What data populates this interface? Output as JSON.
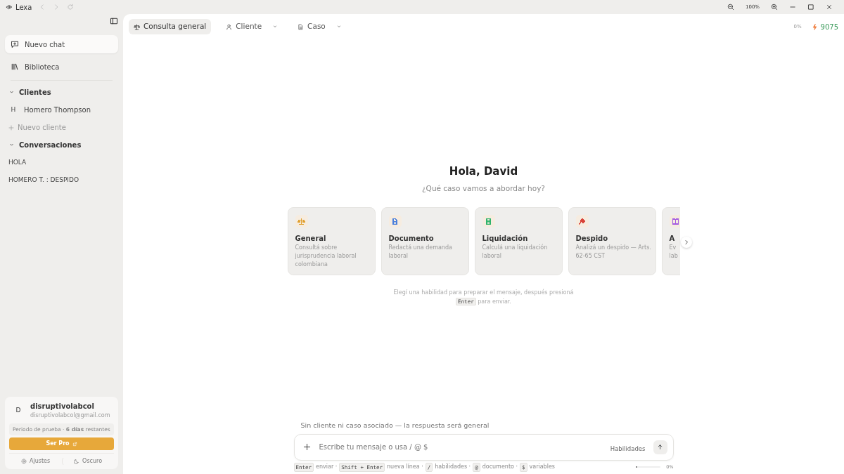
{
  "window": {
    "app_name": "Lexa",
    "zoom": "100%"
  },
  "sidebar": {
    "primary": [
      {
        "label": "Nuevo chat",
        "selected": true
      },
      {
        "label": "Biblioteca",
        "selected": false
      }
    ],
    "sections": [
      {
        "title": "Clientes",
        "expanded": true,
        "items": [
          {
            "initial": "H",
            "label": "Homero Thompson"
          }
        ],
        "add_label": "Nuevo cliente"
      },
      {
        "title": "Conversaciones",
        "expanded": true,
        "items": [
          {
            "label": "HOLA"
          },
          {
            "label": "HOMERO T. : DESPIDO"
          }
        ]
      }
    ],
    "user": {
      "initial": "D",
      "name": "disruptivolabcol",
      "email": "disruptivolabcol@gmail.com",
      "trial": "Periodo de prueba · **6 días** restantes",
      "upgrade": "Ser Pro",
      "settings": "Ajustes",
      "theme": "Oscuro"
    }
  },
  "toolbar": {
    "tabs": [
      {
        "label": "Consulta general",
        "selected": true,
        "dropdown": false
      },
      {
        "label": "Cliente",
        "selected": false,
        "dropdown": true
      },
      {
        "label": "Caso",
        "selected": false,
        "dropdown": true
      }
    ],
    "usage": "0%",
    "credits": "9075"
  },
  "greeting": {
    "title": "Hola, David",
    "subtitle": "¿Qué caso vamos a abordar hoy?"
  },
  "skills": [
    {
      "title": "General",
      "lines": [
        "Consultá sobre",
        "jurisprudencia laboral",
        "colombiana"
      ],
      "color": "#e0a030"
    },
    {
      "title": "Documento",
      "lines": [
        "Redactá una demanda",
        "laboral"
      ],
      "color": "#4a7fdc"
    },
    {
      "title": "Liquidación",
      "lines": [
        "Calculá una liquidación",
        "laboral"
      ],
      "color": "#2fb36b"
    },
    {
      "title": "Despido",
      "lines": [
        "Analizá un despido — Arts.",
        "62-65 CST"
      ],
      "color": "#d9443a"
    },
    {
      "title": "A",
      "lines": [
        "Ev",
        "lab"
      ],
      "color": "#a55be0"
    }
  ],
  "skills_hint": [
    {
      "kind": "text",
      "text": "Elegí una habilidad para preparar el mensaje, después presioná"
    },
    {
      "kind": "key",
      "text": "Enter"
    },
    {
      "kind": "text",
      "text": "para enviar."
    }
  ],
  "composer": {
    "context": "Sin cliente ni caso asociado — la respuesta será general",
    "placeholder": "Escribe tu mensaje o usa / @ $",
    "skills_label": "Habilidades",
    "level": 0,
    "reading": "0%"
  },
  "shortcuts": [
    {
      "kind": "key",
      "text": "Enter"
    },
    {
      "kind": "text",
      "text": "enviar ·"
    },
    {
      "kind": "key",
      "text": "Shift + Enter"
    },
    {
      "kind": "text",
      "text": "nueva línea ·"
    },
    {
      "kind": "key",
      "text": "/"
    },
    {
      "kind": "text",
      "text": "habilidades ·"
    },
    {
      "kind": "key",
      "text": "@"
    },
    {
      "kind": "text",
      "text": "documento ·"
    },
    {
      "kind": "key",
      "text": "$"
    },
    {
      "kind": "text",
      "text": "variables"
    }
  ]
}
